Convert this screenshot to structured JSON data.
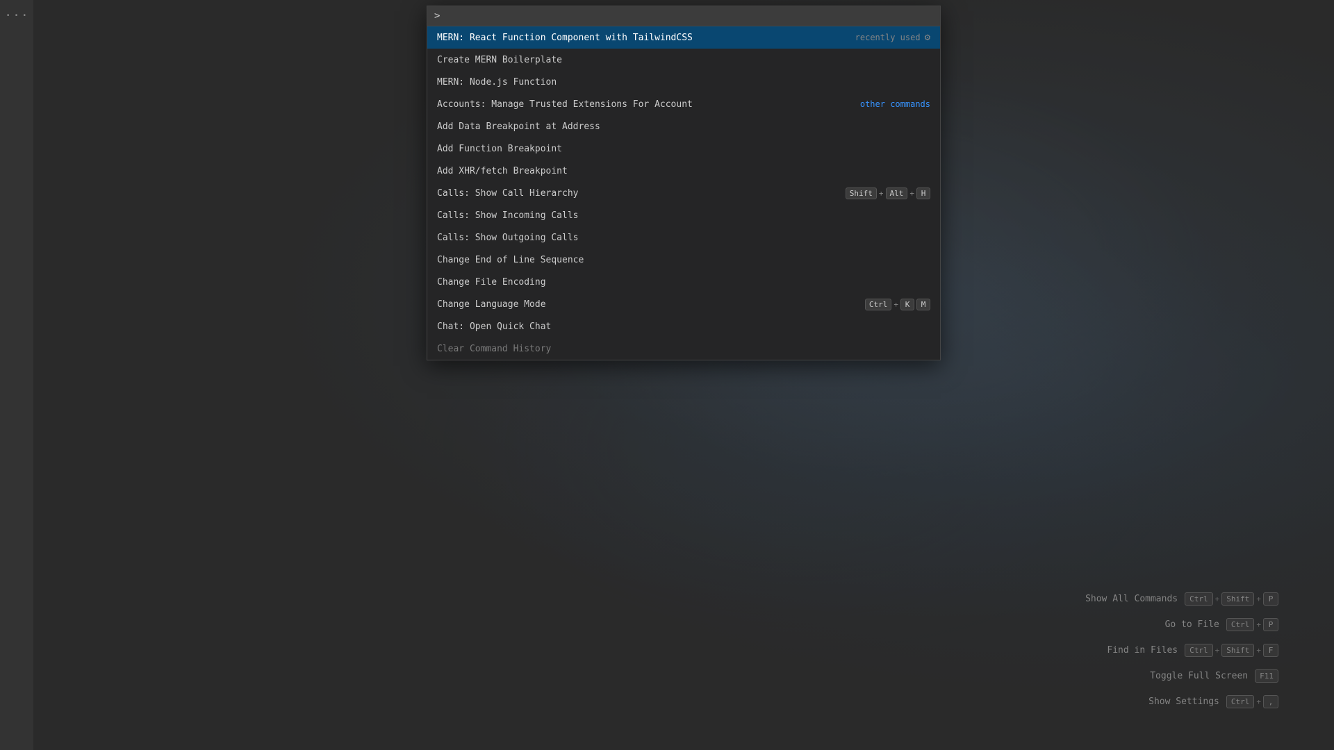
{
  "sidebar": {
    "dots": "···"
  },
  "command_palette": {
    "input": {
      "prefix": ">",
      "placeholder": "",
      "value": ""
    },
    "items": [
      {
        "id": 0,
        "label": "MERN: React Function Component with TailwindCSS",
        "active": true,
        "badge": "recently used",
        "has_gear": true,
        "keybinding": null,
        "other_commands": null
      },
      {
        "id": 1,
        "label": "Create MERN Boilerplate",
        "active": false,
        "badge": null,
        "has_gear": false,
        "keybinding": null,
        "other_commands": null
      },
      {
        "id": 2,
        "label": "MERN: Node.js Function",
        "active": false,
        "badge": null,
        "has_gear": false,
        "keybinding": null,
        "other_commands": null
      },
      {
        "id": 3,
        "label": "Accounts: Manage Trusted Extensions For Account",
        "active": false,
        "badge": null,
        "has_gear": false,
        "keybinding": null,
        "other_commands": "other commands"
      },
      {
        "id": 4,
        "label": "Add Data Breakpoint at Address",
        "active": false,
        "badge": null,
        "has_gear": false,
        "keybinding": null,
        "other_commands": null
      },
      {
        "id": 5,
        "label": "Add Function Breakpoint",
        "active": false,
        "badge": null,
        "has_gear": false,
        "keybinding": null,
        "other_commands": null
      },
      {
        "id": 6,
        "label": "Add XHR/fetch Breakpoint",
        "active": false,
        "badge": null,
        "has_gear": false,
        "keybinding": null,
        "other_commands": null
      },
      {
        "id": 7,
        "label": "Calls: Show Call Hierarchy",
        "active": false,
        "badge": null,
        "has_gear": false,
        "keybinding": [
          "Shift",
          "+",
          "Alt",
          "+",
          "H"
        ],
        "other_commands": null
      },
      {
        "id": 8,
        "label": "Calls: Show Incoming Calls",
        "active": false,
        "badge": null,
        "has_gear": false,
        "keybinding": null,
        "other_commands": null
      },
      {
        "id": 9,
        "label": "Calls: Show Outgoing Calls",
        "active": false,
        "badge": null,
        "has_gear": false,
        "keybinding": null,
        "other_commands": null
      },
      {
        "id": 10,
        "label": "Change End of Line Sequence",
        "active": false,
        "badge": null,
        "has_gear": false,
        "keybinding": null,
        "other_commands": null
      },
      {
        "id": 11,
        "label": "Change File Encoding",
        "active": false,
        "badge": null,
        "has_gear": false,
        "keybinding": null,
        "other_commands": null
      },
      {
        "id": 12,
        "label": "Change Language Mode",
        "active": false,
        "badge": null,
        "has_gear": false,
        "keybinding": [
          "Ctrl",
          "+",
          "K",
          "M"
        ],
        "other_commands": null
      },
      {
        "id": 13,
        "label": "Chat: Open Quick Chat",
        "active": false,
        "badge": null,
        "has_gear": false,
        "keybinding": null,
        "other_commands": null
      },
      {
        "id": 14,
        "label": "Clear Command History",
        "active": false,
        "badge": null,
        "has_gear": false,
        "keybinding": null,
        "other_commands": null,
        "partially_visible": true
      }
    ]
  },
  "bottom_shortcuts": [
    {
      "label": "Show All Commands",
      "keys": [
        "Ctrl",
        "+",
        "Shift",
        "+",
        "P"
      ]
    },
    {
      "label": "Go to File",
      "keys": [
        "Ctrl",
        "+",
        "P"
      ]
    },
    {
      "label": "Find in Files",
      "keys": [
        "Ctrl",
        "+",
        "Shift",
        "+",
        "F"
      ]
    },
    {
      "label": "Toggle Full Screen",
      "keys": [
        "F11"
      ]
    },
    {
      "label": "Show Settings",
      "keys": [
        "Ctrl",
        "+",
        ","
      ]
    }
  ],
  "colors": {
    "active_bg": "#094771",
    "item_hover": "#2a2d2e",
    "text_primary": "#cccccc",
    "text_secondary": "#858585",
    "text_link": "#3794ff",
    "bg_palette": "#252526",
    "bg_input": "#3c3c3c"
  }
}
